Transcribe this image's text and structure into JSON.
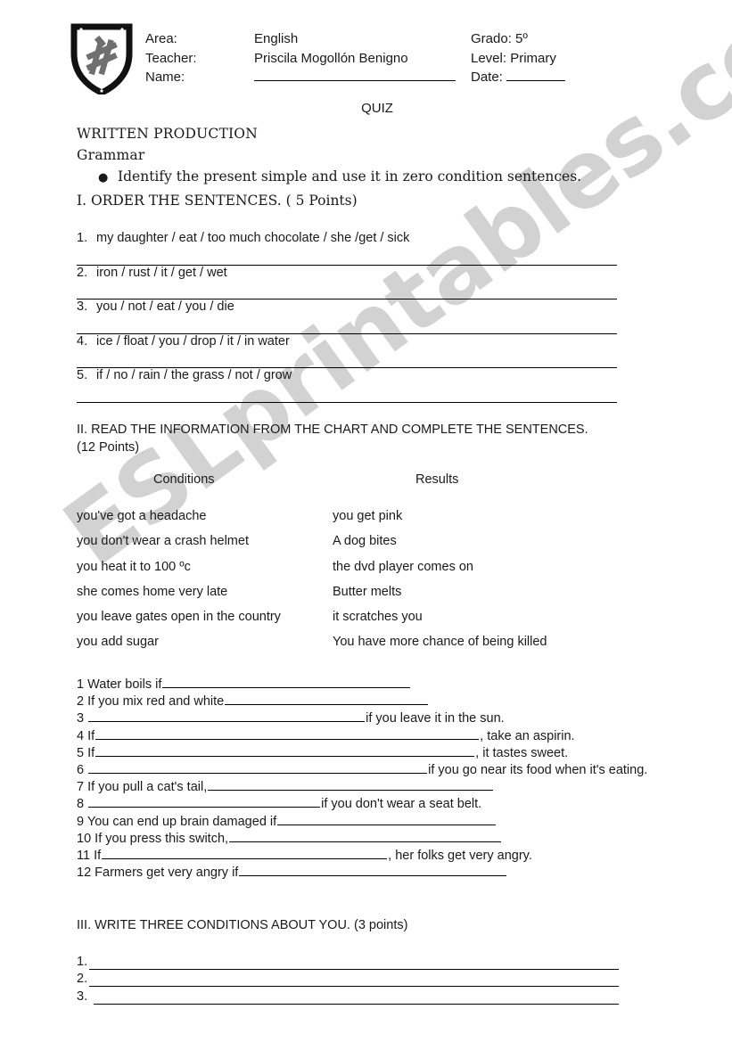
{
  "header": {
    "logo_alt": "school-crest",
    "fields": [
      {
        "label": "Area:",
        "value": "English"
      },
      {
        "label": "Teacher:",
        "value": "Priscila Mogollón Benigno"
      },
      {
        "label": "Name:",
        "value": ""
      }
    ],
    "right": [
      {
        "label": "Grado:",
        "value": "5º"
      },
      {
        "label": "Level:",
        "value": "Primary"
      },
      {
        "label": "Date:",
        "value": ""
      }
    ]
  },
  "quiz_title": "QUIZ",
  "headings": {
    "written_production": "WRITTEN PRODUCTION",
    "grammar": "Grammar",
    "objective_bullet": "Identify the present simple and use it in zero condition sentences."
  },
  "section1": {
    "title": "I. ORDER THE SENTENCES. ( 5 Points)",
    "items": [
      {
        "num": "1.",
        "text": "my daughter / eat / too much chocolate / she /get / sick"
      },
      {
        "num": "2.",
        "text": "iron / rust / it / get / wet"
      },
      {
        "num": "3.",
        "text": "you / not / eat / you / die"
      },
      {
        "num": "4.",
        "text": "ice / float / you / drop / it / in water"
      },
      {
        "num": "5.",
        "text": "if / no / rain / the grass / not / grow"
      }
    ]
  },
  "section2": {
    "title": "II. READ THE INFORMATION FROM THE CHART AND COMPLETE THE SENTENCES. (12 Points)",
    "column_headers": {
      "conditions": "Conditions",
      "results": "Results"
    },
    "conditions": [
      "you've got a headache",
      "you don't wear a crash helmet",
      "you heat it to 100 ºc",
      "she comes home very late",
      "you leave gates open in the country",
      "you add sugar"
    ],
    "results": [
      "you get pink",
      "A dog bites",
      "the dvd player comes on",
      "Butter melts",
      "it scratches you",
      "You have more chance of being killed"
    ],
    "sentences": [
      {
        "num": "1",
        "before": "Water boils if",
        "blank": 278,
        "after": ""
      },
      {
        "num": "2",
        "before": "If you mix red and white",
        "blank": 228,
        "after": ""
      },
      {
        "num": "3",
        "before": "",
        "blank": 310,
        "after": "if you leave it in the sun."
      },
      {
        "num": "4",
        "before": "If",
        "blank": 430,
        "after": ", take an aspirin."
      },
      {
        "num": "5",
        "before": "If",
        "blank": 425,
        "after": ", it tastes sweet."
      },
      {
        "num": "6",
        "before": "",
        "blank": 380,
        "after": "if you go near its food when it's eating."
      },
      {
        "num": "7",
        "before": "If you pull a cat's tail,",
        "blank": 320,
        "after": ""
      },
      {
        "num": "8",
        "before": "",
        "blank": 260,
        "after": "if you don't wear a seat belt."
      },
      {
        "num": "9",
        "before": "You can end up brain damaged if",
        "blank": 245,
        "after": ""
      },
      {
        "num": "10",
        "before": "If you press this switch,",
        "blank": 305,
        "after": ""
      },
      {
        "num": "11",
        "before": "If",
        "blank": 320,
        "after": ", her folks get very angry."
      },
      {
        "num": "12",
        "before": "Farmers get very angry if",
        "blank": 300,
        "after": ""
      }
    ]
  },
  "section3": {
    "title": "III. WRITE THREE CONDITIONS ABOUT YOU. (3 points)",
    "answers": [
      {
        "num": "1."
      },
      {
        "num": "2."
      },
      {
        "num": "3."
      }
    ]
  },
  "watermark": {
    "text": "ESLprintables.com",
    "color": "#d2d2d2"
  }
}
